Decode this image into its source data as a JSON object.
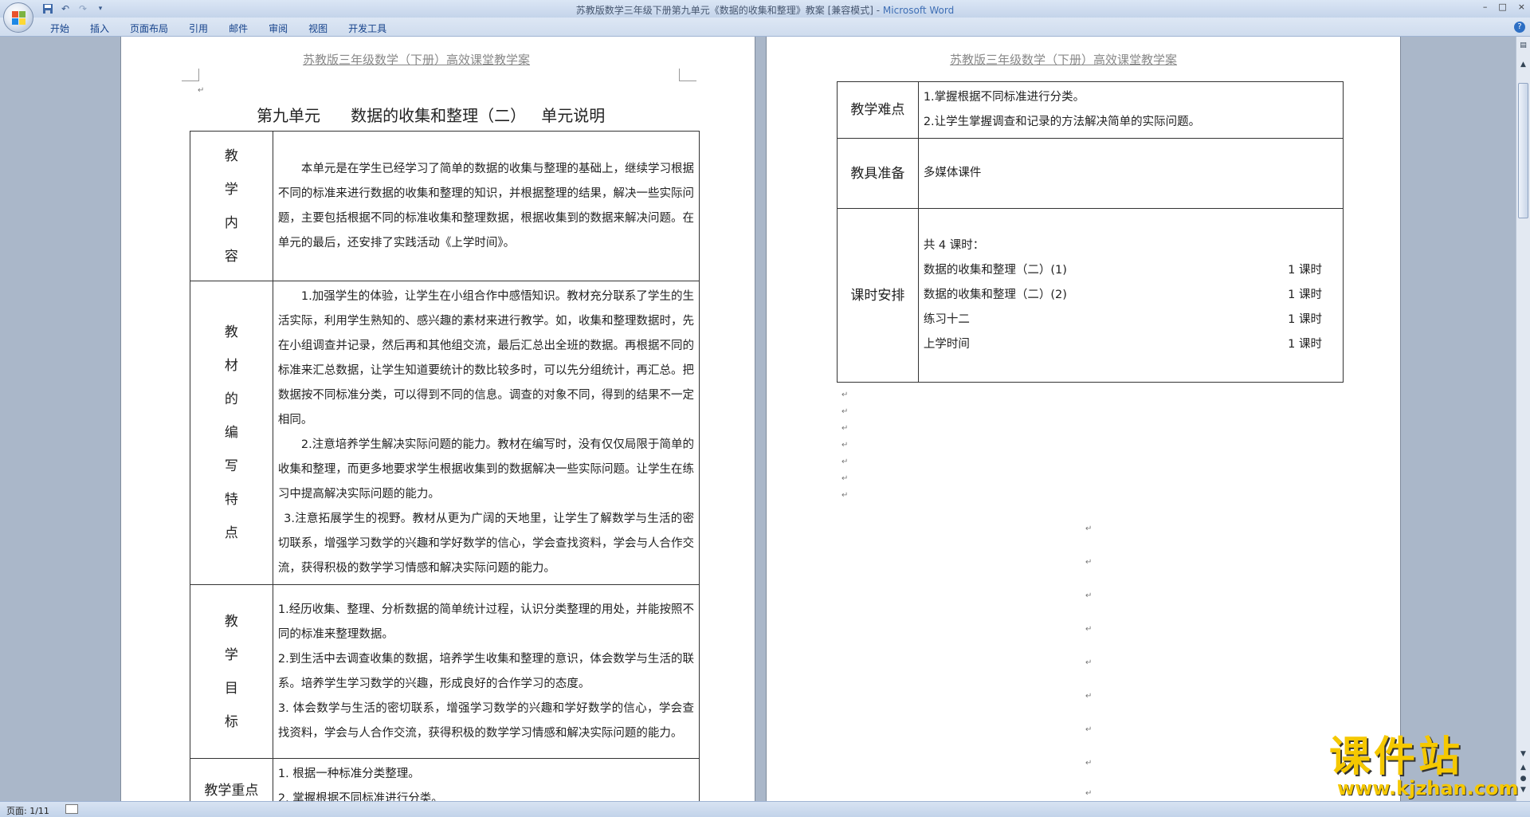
{
  "window": {
    "title": "苏教版数学三年级下册第九单元《数据的收集和整理》教案 [兼容模式] - ",
    "app_name": "Microsoft Word",
    "controls": [
      "–",
      "□",
      "×"
    ]
  },
  "qat": {
    "save_icon": "save-icon",
    "undo": "↶",
    "redo": "↷",
    "more": "▾"
  },
  "ribbon": {
    "tabs": [
      "开始",
      "插入",
      "页面布局",
      "引用",
      "邮件",
      "审阅",
      "视图",
      "开发工具"
    ],
    "help": "?"
  },
  "page1": {
    "header": "苏教版三年级数学（下册）高效课堂教学案",
    "title": "第九单元      数据的收集和整理（二）   单元说明",
    "rows": {
      "content_label": [
        "教",
        "学",
        "内",
        "容"
      ],
      "content_text": "本单元是在学生已经学习了简单的数据的收集与整理的基础上，继续学习根据不同的标准来进行数据的收集和整理的知识，并根据整理的结果，解决一些实际问题，主要包括根据不同的标准收集和整理数据，根据收集到的数据来解决问题。在单元的最后，还安排了实践活动《上学时间》。",
      "features_label": [
        "教",
        "材",
        "的",
        "编",
        "写",
        "特",
        "点"
      ],
      "features_p1": "1.加强学生的体验，让学生在小组合作中感悟知识。教材充分联系了学生的生活实际，利用学生熟知的、感兴趣的素材来进行教学。如，收集和整理数据时，先在小组调查并记录，然后再和其他组交流，最后汇总出全班的数据。再根据不同的标准来汇总数据，让学生知道要统计的数比较多时，可以先分组统计，再汇总。把数据按不同标准分类，可以得到不同的信息。调查的对象不同，得到的结果不一定相同。",
      "features_p2": "2.注意培养学生解决实际问题的能力。教材在编写时，没有仅仅局限于简单的收集和整理，而更多地要求学生根据收集到的数据解决一些实际问题。让学生在练习中提高解决实际问题的能力。",
      "features_p3": "3.注意拓展学生的视野。教材从更为广阔的天地里，让学生了解数学与生活的密切联系，增强学习数学的兴趣和学好数学的信心，学会查找资料，学会与人合作交流，获得积极的数学学习情感和解决实际问题的能力。",
      "goals_label": [
        "教",
        "学",
        "目",
        "标"
      ],
      "goals_p1": "1.经历收集、整理、分析数据的简单统计过程，认识分类整理的用处，并能按照不同的标准来整理数据。",
      "goals_p2": "2.到生活中去调查收集的数据，培养学生收集和整理的意识，体会数学与生活的联系。培养学生学习数学的兴趣，形成良好的合作学习的态度。",
      "goals_p3": "3. 体会数学与生活的密切联系，增强学习数学的兴趣和学好数学的信心，学会查找资料，学会与人合作交流，获得积极的数学学习情感和解决实际问题的能力。",
      "keypoints_label": "教学重点",
      "keypoints_p1": "1. 根据一种标准分类整理。",
      "keypoints_p2": "2. 掌握根据不同标准进行分类。"
    }
  },
  "page2": {
    "header": "苏教版三年级数学（下册）高效课堂教学案",
    "difficulty_label": "教学难点",
    "difficulty_p1": "1.掌握根据不同标准进行分类。",
    "difficulty_p2": "2.让学生掌握调查和记录的方法解决简单的实际问题。",
    "prep_label": "教具准备",
    "prep_text": "多媒体课件",
    "schedule_label": "课时安排",
    "schedule_total": "共 4 课时：",
    "schedule_items": [
      {
        "name": "数据的收集和整理（二）(1)",
        "hours": "1 课时"
      },
      {
        "name": "数据的收集和整理（二）(2)",
        "hours": "1 课时"
      },
      {
        "name": "练习十二",
        "hours": "1 课时"
      },
      {
        "name": "上学时间",
        "hours": "1 课时"
      }
    ]
  },
  "paragraph_mark": "↵",
  "statusbar": {
    "page_count": "页面: 1/11"
  },
  "watermark": {
    "main": "课件站",
    "url": "www.kjzhan.com"
  }
}
